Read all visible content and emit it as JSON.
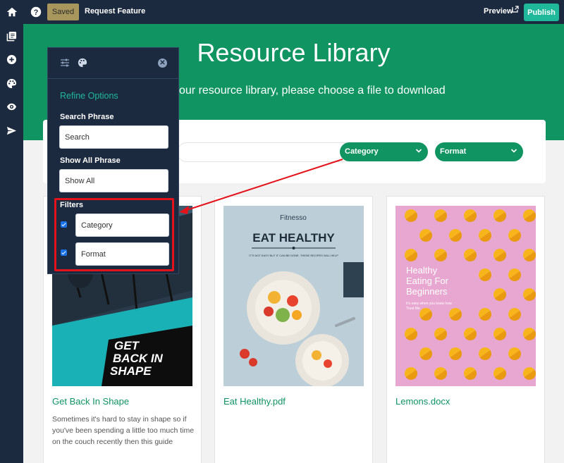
{
  "topbar": {
    "saved_label": "Saved",
    "request_feature": "Request Feature",
    "preview_label": "Preview",
    "publish_label": "Publish"
  },
  "rail": {
    "icons": [
      "home-icon",
      "library-icon",
      "add-icon",
      "palette-icon",
      "eye-icon",
      "send-icon"
    ]
  },
  "hero": {
    "title": "Resource Library",
    "subtitle": "our resource library, please choose a file to download"
  },
  "filters_bar": {
    "category_label": "Category",
    "format_label": "Format"
  },
  "panel": {
    "heading": "Refine Options",
    "search_phrase_label": "Search Phrase",
    "search_phrase_value": "Search",
    "show_all_label": "Show All Phrase",
    "show_all_value": "Show All",
    "filters_label": "Filters",
    "filter_category": "Category",
    "filter_format": "Format",
    "filter_category_checked": true,
    "filter_format_checked": true
  },
  "cards": [
    {
      "title": "Get Back In Shape",
      "description": "Sometimes it's hard to stay in shape so if you've been spending a little too much time on the couch recently then this guide",
      "cover_text": "GET BACK IN SHAPE"
    },
    {
      "title": "Eat Healthy.pdf",
      "brand": "Fitnesso",
      "cover_title": "EAT HEALTHY",
      "cover_sub": "IT'S NOT EASY BUT IT CAN BE DONE. THESE RECIPES WILL HELP"
    },
    {
      "title": "Lemons.docx",
      "cover_title": "Healthy Eating For Beginners",
      "cover_sub": "It's easy when you know how. Trust Me."
    }
  ],
  "colors": {
    "brand_green": "#0f9462",
    "accent_teal": "#1fb89b",
    "navy": "#1c2a40",
    "highlight_red": "#e3131b"
  }
}
